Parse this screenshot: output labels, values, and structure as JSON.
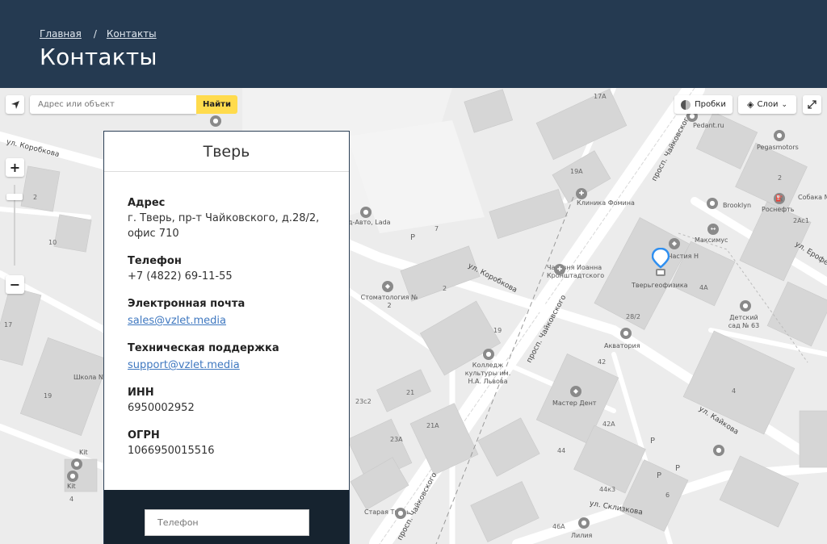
{
  "breadcrumb": {
    "home": "Главная",
    "separator": "/",
    "current": "Контакты"
  },
  "page_title": "Контакты",
  "map": {
    "search_placeholder": "Адрес или объект",
    "search_button": "Найти",
    "traffic_label": "Пробки",
    "layers_label": "Слои",
    "zoom_in": "+",
    "zoom_out": "−",
    "streets": {
      "korobkova_top": "ул. Коробкова",
      "korobkova_mid": "ул. Коробкова",
      "chaykovskogo_top": "просп. Чайковского",
      "chaykovskogo_mid": "просп. Чайковского",
      "chaykovskogo_bottom": "просп. Чайковского",
      "kaykova": "ул. Кайкова",
      "sklizkova": "ул. Склизкова",
      "erofeeva": "ул. Ерофе"
    },
    "places": {
      "pedant": "Pedant.ru",
      "pegasmotors": "Pegasmotors",
      "sobaka": "Собака М",
      "brooklyn": "Brooklyn",
      "rosneft": "Роснефть",
      "klinika_fomina": "Клиника Фомина",
      "maksimus": "Максимус",
      "chastiya": "Частия Н",
      "chasovnya": "Часовня Иоанна Кронштадтского",
      "tvergeofizika": "Тверьгеофизика",
      "stomatologiya": "Стоматология № 2",
      "akvatoriya": "Акватория",
      "detskiy_sad": "Детский сад № 63",
      "kolledzh": "Колледж культуры им. Н.А. Львова",
      "master_dent": "Мастер Дент",
      "shkola": "Школа N",
      "kit1": "Kit",
      "kit2": "Kit",
      "staraya_tver": "Старая Тверь",
      "liliya": "Лилия",
      "avto_lada": "д-Авто, Lada"
    },
    "numbers": [
      "17A",
      "19A",
      "2",
      "2",
      "2Ac1",
      "4A",
      "28/2",
      "4",
      "42",
      "42A",
      "44",
      "44к3",
      "46A",
      "6",
      "23c2",
      "21",
      "21A",
      "23A",
      "19",
      "2",
      "7",
      "10",
      "17",
      "19",
      "4",
      "P",
      "P",
      "P",
      "P"
    ]
  },
  "card": {
    "city": "Тверь",
    "fields": [
      {
        "label": "Адрес",
        "value": "г. Тверь, пр-т Чайковского, д.28/2, офис 710"
      },
      {
        "label": "Телефон",
        "value": "+7 (4822) 69-11-55"
      },
      {
        "label": "Электронная почта",
        "value": "sales@vzlet.media"
      },
      {
        "label": "Техническая поддержка",
        "value": "support@vzlet.media"
      },
      {
        "label": "ИНН",
        "value": "6950002952"
      },
      {
        "label": "ОГРН",
        "value": "1066950015516"
      }
    ],
    "phone_placeholder": "Телефон"
  },
  "colors": {
    "header_bg": "#253a51",
    "footer_bg": "#16232f",
    "link": "#3f78c0",
    "search_button": "#ffdb4d",
    "pin": "#2f8ff0"
  }
}
